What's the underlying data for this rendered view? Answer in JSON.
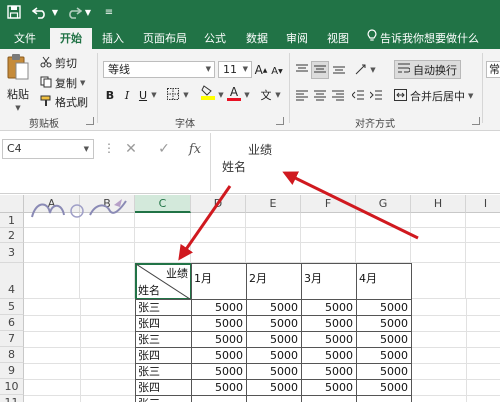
{
  "quick_access": {
    "save_icon": "save-icon",
    "undo_icon": "undo-icon",
    "redo_icon": "redo-icon"
  },
  "tabs": [
    {
      "label": "文件",
      "active": false
    },
    {
      "label": "开始",
      "active": true
    },
    {
      "label": "插入",
      "active": false
    },
    {
      "label": "页面布局",
      "active": false
    },
    {
      "label": "公式",
      "active": false
    },
    {
      "label": "数据",
      "active": false
    },
    {
      "label": "审阅",
      "active": false
    },
    {
      "label": "视图",
      "active": false
    }
  ],
  "tell_me": "告诉我你想要做什么",
  "ribbon": {
    "clipboard": {
      "paste": "粘贴",
      "cut": "剪切",
      "copy": "复制",
      "format_painter": "格式刷",
      "label": "剪贴板"
    },
    "font": {
      "name": "等线",
      "size": "11",
      "grow": "A",
      "shrink": "A",
      "bold": "B",
      "italic": "I",
      "underline": "U",
      "phonetic": "文",
      "label": "字体",
      "fill_color": "#ffff00",
      "font_color": "#e81123"
    },
    "alignment": {
      "wrap_text": "自动换行",
      "merge_center": "合并后居中",
      "label": "对齐方式",
      "number_format": "常"
    }
  },
  "formula_bar": {
    "name_box": "C4",
    "cancel": "✕",
    "enter": "✓",
    "fx": "fx",
    "line1": "业绩",
    "line2": "姓名"
  },
  "sheet": {
    "columns": [
      "A",
      "B",
      "C",
      "D",
      "E",
      "F",
      "G",
      "H",
      "I"
    ],
    "selected_column": "C",
    "rows": [
      "1",
      "2",
      "3",
      "4",
      "5",
      "6",
      "7",
      "8",
      "9",
      "10",
      "11"
    ],
    "header_row": {
      "diag_top": "业绩",
      "diag_bottom": "姓名",
      "months": [
        "1月",
        "2月",
        "3月",
        "4月"
      ]
    },
    "data": [
      {
        "name": "张三",
        "values": [
          "5000",
          "5000",
          "5000",
          "5000"
        ]
      },
      {
        "name": "张四",
        "values": [
          "5000",
          "5000",
          "5000",
          "5000"
        ]
      },
      {
        "name": "张三",
        "values": [
          "5000",
          "5000",
          "5000",
          "5000"
        ]
      },
      {
        "name": "张四",
        "values": [
          "5000",
          "5000",
          "5000",
          "5000"
        ]
      },
      {
        "name": "张三",
        "values": [
          "5000",
          "5000",
          "5000",
          "5000"
        ]
      },
      {
        "name": "张四",
        "values": [
          "5000",
          "5000",
          "5000",
          "5000"
        ]
      },
      {
        "name": "张三",
        "values": [
          "",
          "",
          "",
          ""
        ]
      }
    ]
  },
  "colors": {
    "accent": "#217346",
    "arrow": "#d0191f"
  }
}
